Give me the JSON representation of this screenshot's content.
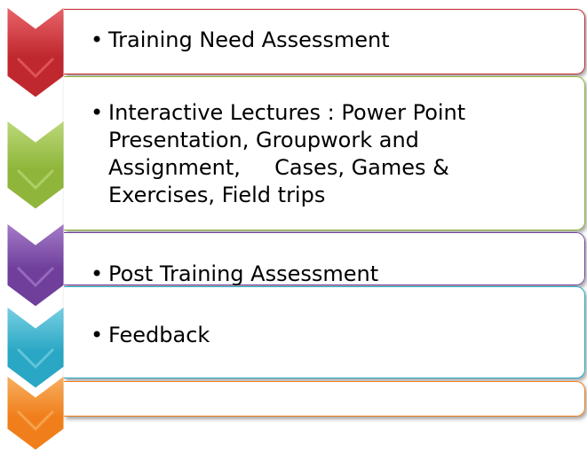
{
  "steps": [
    {
      "color": "#c0282f",
      "light": "#e8656a",
      "items": [
        "Training Need Assessment"
      ]
    },
    {
      "color": "#8fb63a",
      "light": "#bcd97a",
      "items": [
        "Interactive Lectures : Power Point Presentation, Groupwork and Assignment,     Cases, Games & Exercises, Field trips"
      ]
    },
    {
      "color": "#6f3f9b",
      "light": "#a57cc9",
      "items": [
        "Post Training Assessment"
      ]
    },
    {
      "color": "#2aa7c4",
      "light": "#79d0e3",
      "items": [
        "Feedback"
      ]
    },
    {
      "color": "#f07f1b",
      "light": "#f7b062",
      "items": []
    }
  ],
  "bullet_char": "•"
}
